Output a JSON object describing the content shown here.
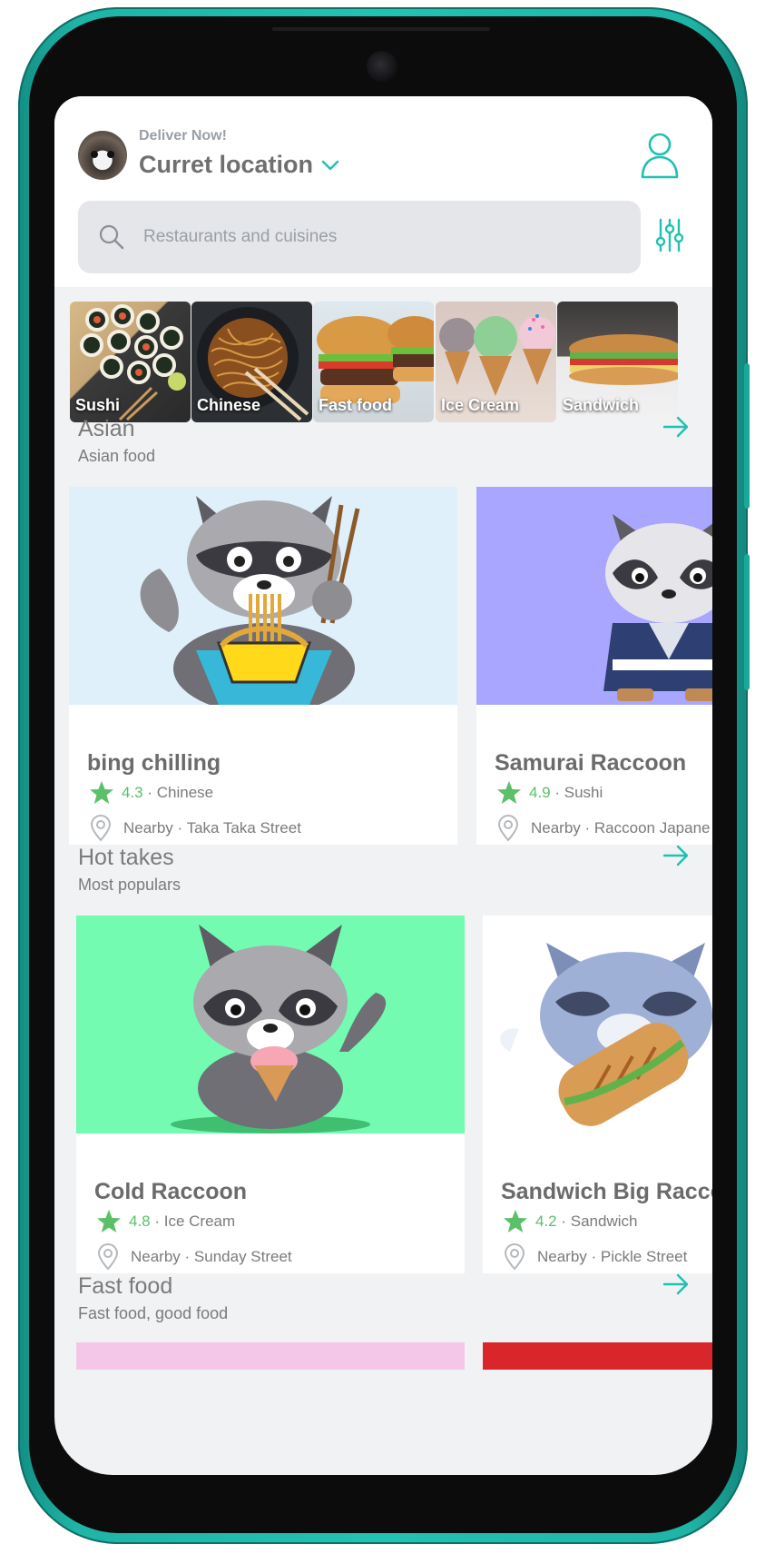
{
  "header": {
    "deliver_label": "Deliver Now!",
    "location": "Curret location"
  },
  "search": {
    "placeholder": "Restaurants and cuisines"
  },
  "categories": [
    {
      "label": "Sushi"
    },
    {
      "label": "Chinese"
    },
    {
      "label": "Fast food"
    },
    {
      "label": "Ice Cream"
    },
    {
      "label": "Sandwich"
    }
  ],
  "sections": [
    {
      "title": "Asian",
      "subtitle": "Asian food",
      "cards": [
        {
          "name": "bing chilling",
          "rating": "4.3",
          "cuisine": "Chinese",
          "location": "Nearby · Taka Taka Street",
          "bg": "#dff0fb"
        },
        {
          "name": "Samurai Raccoon",
          "rating": "4.9",
          "cuisine": "Sushi",
          "location": "Nearby · Raccoon Japane",
          "bg": "#a8a6ff"
        }
      ]
    },
    {
      "title": "Hot takes",
      "subtitle": "Most populars",
      "cards": [
        {
          "name": "Cold Raccoon",
          "rating": "4.8",
          "cuisine": "Ice Cream",
          "location": "Nearby · Sunday Street",
          "bg": "#72fbb1"
        },
        {
          "name": "Sandwich Big Raccoo",
          "rating": "4.2",
          "cuisine": "Sandwich",
          "location": "Nearby · Pickle Street",
          "bg": "#ffffff"
        }
      ]
    },
    {
      "title": "Fast food",
      "subtitle": "Fast food, good food"
    }
  ],
  "colors": {
    "accent": "#1fc1b0",
    "star": "#5cbf6a",
    "frame": "#22c2b1"
  }
}
